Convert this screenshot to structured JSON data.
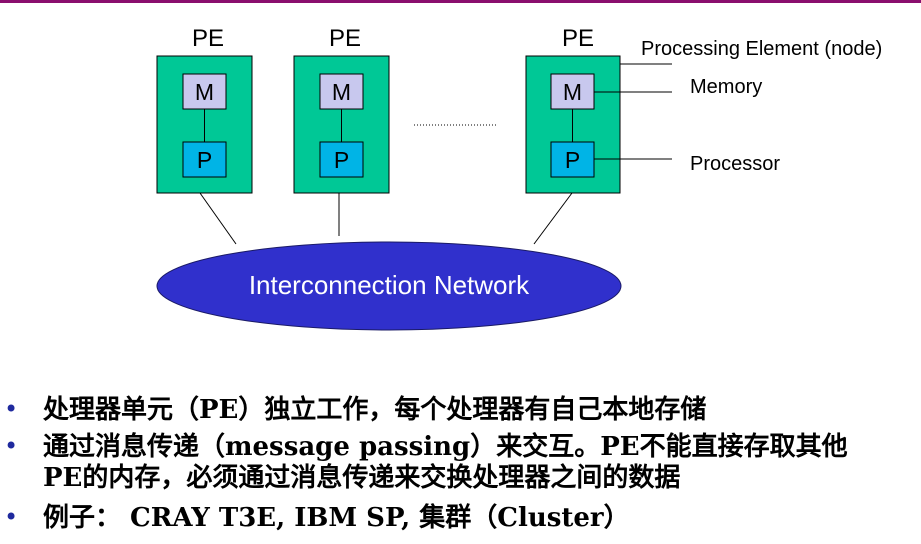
{
  "diagram": {
    "pe_label": "PE",
    "memory_box_label": "M",
    "processor_box_label": "P",
    "callout_node": "Processing Element (node)",
    "callout_memory": "Memory",
    "callout_processor": "Processor",
    "network_label": "Interconnection Network",
    "colors": {
      "pe_fill": "#00c896",
      "memory_fill": "#c8c8ee",
      "processor_fill": "#00b4e6",
      "network_fill": "#3030cc",
      "bullet": "#1f2a9e",
      "top_rule": "#8a0f6e"
    }
  },
  "bullets": [
    {
      "lines": [
        "处理器单元（PE）独立工作，每个处理器有自己本地存储"
      ]
    },
    {
      "lines": [
        "通过消息传递（message passing）来交互。PE不能直接存取其他",
        "PE的内存，必须通过消息传递来交换处理器之间的数据"
      ]
    },
    {
      "lines": [
        "例子： CRAY T3E, IBM SP, 集群（Cluster）"
      ]
    }
  ]
}
